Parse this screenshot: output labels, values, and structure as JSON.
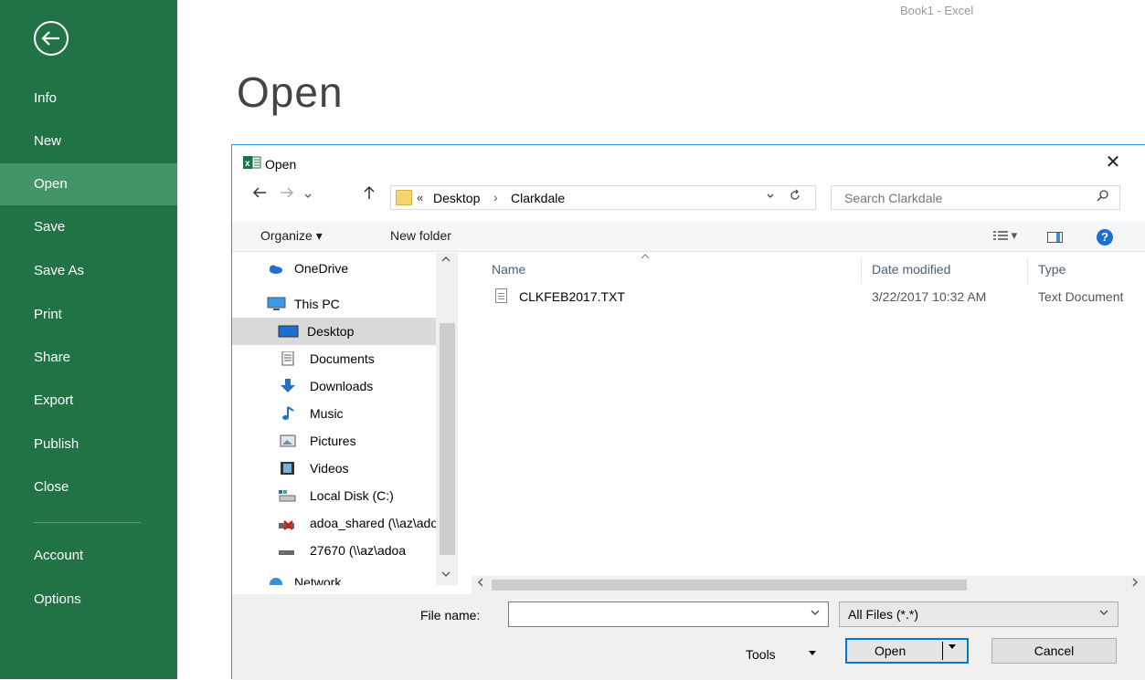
{
  "window": {
    "title": "Book1 - Excel"
  },
  "sidebar": {
    "items": [
      {
        "label": "Info"
      },
      {
        "label": "New"
      },
      {
        "label": "Open"
      },
      {
        "label": "Save"
      },
      {
        "label": "Save As"
      },
      {
        "label": "Print"
      },
      {
        "label": "Share"
      },
      {
        "label": "Export"
      },
      {
        "label": "Publish"
      },
      {
        "label": "Close"
      },
      {
        "label": "Account"
      },
      {
        "label": "Options"
      }
    ],
    "accent": "#217346",
    "active_color": "#439467"
  },
  "page": {
    "title": "Open"
  },
  "dialog": {
    "title": "Open",
    "close": "✕",
    "address": {
      "chevrons": "«",
      "part1": "Desktop",
      "separator": "›",
      "part2": "Clarkdale"
    },
    "search": {
      "placeholder": "Search Clarkdale"
    },
    "toolbar": {
      "organize": "Organize ▾",
      "new_folder": "New folder",
      "view": "▾",
      "help": "?"
    },
    "tree": [
      {
        "label": "OneDrive",
        "icon": "cloud-icon"
      },
      {
        "label": "This PC",
        "icon": "computer-icon"
      },
      {
        "label": "Desktop",
        "icon": "desktop-icon"
      },
      {
        "label": "Documents",
        "icon": "documents-icon"
      },
      {
        "label": "Downloads",
        "icon": "download-icon"
      },
      {
        "label": "Music",
        "icon": "music-icon"
      },
      {
        "label": "Pictures",
        "icon": "pictures-icon"
      },
      {
        "label": "Videos",
        "icon": "videos-icon"
      },
      {
        "label": "Local Disk (C:)",
        "icon": "disk-icon"
      },
      {
        "label": "adoa_shared (\\\\az\\adoa",
        "icon": "network-drive-disconnected-icon"
      },
      {
        "label": "27670 (\\\\az\\adoa",
        "icon": "network-drive-icon"
      },
      {
        "label": "Network",
        "icon": "network-icon"
      }
    ],
    "columns": {
      "name": "Name",
      "date": "Date modified",
      "type": "Type"
    },
    "files": [
      {
        "name": "CLKFEB2017.TXT",
        "date": "3/22/2017 10:32 AM",
        "type": "Text Document"
      }
    ],
    "bottom": {
      "file_name_label": "File name:",
      "file_name_value": "",
      "file_type": "All Files (*.*)",
      "tools": "Tools",
      "open": "Open",
      "cancel": "Cancel"
    }
  }
}
